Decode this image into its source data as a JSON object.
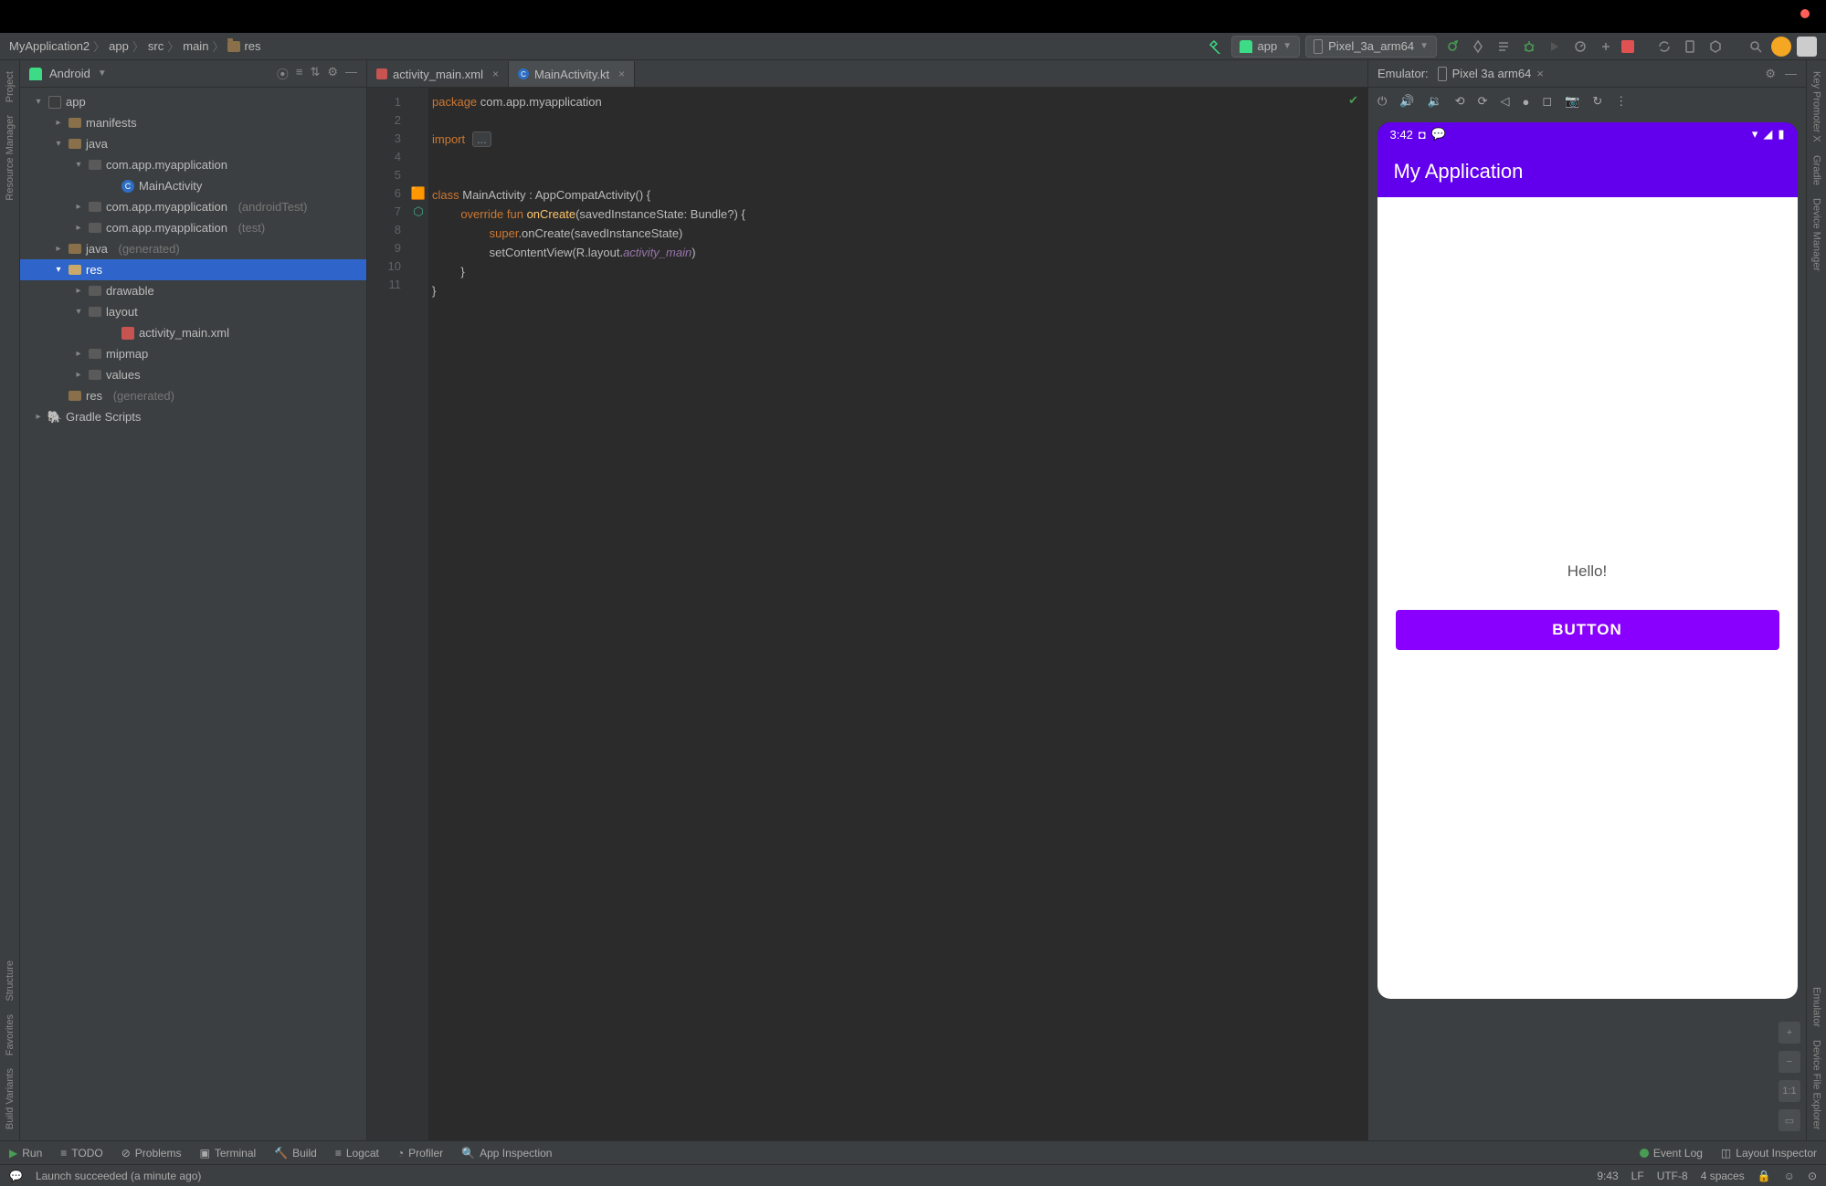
{
  "breadcrumbs": [
    "MyApplication2",
    "app",
    "src",
    "main",
    "res"
  ],
  "run_config": "app",
  "device_selector": "Pixel_3a_arm64",
  "project_selector": "Android",
  "project_tree": {
    "root": "app",
    "manifests": "manifests",
    "java": "java",
    "pkg": "com.app.myapplication",
    "main_activity": "MainActivity",
    "pkg_android_test": "com.app.myapplication",
    "pkg_android_test_suffix": "(androidTest)",
    "pkg_test": "com.app.myapplication",
    "pkg_test_suffix": "(test)",
    "java_gen": "java",
    "java_gen_suffix": "(generated)",
    "res": "res",
    "drawable": "drawable",
    "layout": "layout",
    "activity_main_xml": "activity_main.xml",
    "mipmap": "mipmap",
    "values": "values",
    "res_gen": "res",
    "res_gen_suffix": "(generated)",
    "gradle": "Gradle Scripts"
  },
  "editor_tabs": [
    {
      "label": "activity_main.xml",
      "active": false
    },
    {
      "label": "MainActivity.kt",
      "active": true
    }
  ],
  "code": {
    "line1_kw": "package",
    "line1_rest": " com.app.myapplication",
    "line3_kw": "import",
    "line3_dots": "...",
    "line6_kw": "class",
    "line6_rest1": " MainActivity : AppCompatActivity() {",
    "line7_kw": "override fun",
    "line7_fn": " onCreate",
    "line7_rest": "(savedInstanceState: Bundle?) {",
    "line8_kw": "super",
    "line8_rest": ".onCreate(savedInstanceState)",
    "line9_pre": "setContentView(R.layout.",
    "line9_it": "activity_main",
    "line9_post": ")",
    "line10": "}",
    "line11": "}"
  },
  "line_numbers": [
    "1",
    "2",
    "3",
    "4",
    "5",
    "6",
    "7",
    "8",
    "9",
    "10",
    "11"
  ],
  "emulator": {
    "label": "Emulator:",
    "device": "Pixel 3a arm64",
    "status_time": "3:42",
    "app_title": "My Application",
    "hello": "Hello!",
    "button": "BUTTON",
    "zoom_11": "1:1"
  },
  "left_rail": {
    "project": "Project",
    "resource_manager": "Resource Manager",
    "structure": "Structure",
    "favorites": "Favorites",
    "build_variants": "Build Variants"
  },
  "right_rail": {
    "key_promoter": "Key Promoter X",
    "gradle": "Gradle",
    "device_manager": "Device Manager",
    "emulator": "Emulator",
    "device_explorer": "Device File Explorer"
  },
  "bottom_bar": {
    "run": "Run",
    "todo": "TODO",
    "problems": "Problems",
    "terminal": "Terminal",
    "build": "Build",
    "logcat": "Logcat",
    "profiler": "Profiler",
    "app_inspection": "App Inspection",
    "event_log": "Event Log",
    "layout_inspector": "Layout Inspector"
  },
  "status_bar": {
    "msg": "Launch succeeded (a minute ago)",
    "time": "9:43",
    "lf": "LF",
    "enc": "UTF-8",
    "indent": "4 spaces"
  }
}
